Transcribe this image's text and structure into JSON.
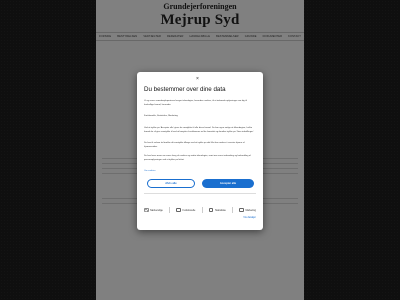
{
  "site": {
    "subtitle": "Grundejerforeningen",
    "title": "Mejrup Syd"
  },
  "nav": {
    "items": [
      "FORSIDE",
      "BESTYRELSEN",
      "VEDTÆGTER",
      "REFERATER",
      "HANDELSBILLE",
      "BESTEMMELSER",
      "GRUNDE",
      "DOKUMENTER",
      "KONTAKT"
    ]
  },
  "cookie_dialog": {
    "close_symbol": "×",
    "title": "Du bestemmer over dine data",
    "intro": "Vi og vores samarbejdspartnere bruger teknologier, herunder cookies, til at indsamle oplysninger om dig til forskellige formål, herunder:",
    "purposes": "Funktionelle, Statistiske, Marketing",
    "body": "Ved at trykke på 'Accepter alle' giver du samtykke til alle disse formål. Du kan også vælge at tilkendegive, hvilke formål du vil give samtykke til ved at benytte checkboxene ud for formålet og derefter trykke på 'Gem indstillinger'.",
    "body2": "Du kan til enhver tid trække dit samtykke tilbage ved at trykke på det lille ikon nederst i venstre hjørne af hjemmesiden.",
    "more": "Du kan læse mere om vores brug af cookies og andre teknologier, samt om vores indsamling og behandling af personoplysninger ved at trykke på linket.",
    "link": "Om cookies",
    "deny_label": "Afvis alle",
    "accept_label": "Accepter alle",
    "checkboxes": [
      {
        "label": "Nødvendige",
        "checked": true
      },
      {
        "label": "Funktionelle",
        "checked": false
      },
      {
        "label": "Statistiske",
        "checked": false
      },
      {
        "label": "Marketing",
        "checked": false
      }
    ],
    "details_link": "Vis detaljer"
  }
}
